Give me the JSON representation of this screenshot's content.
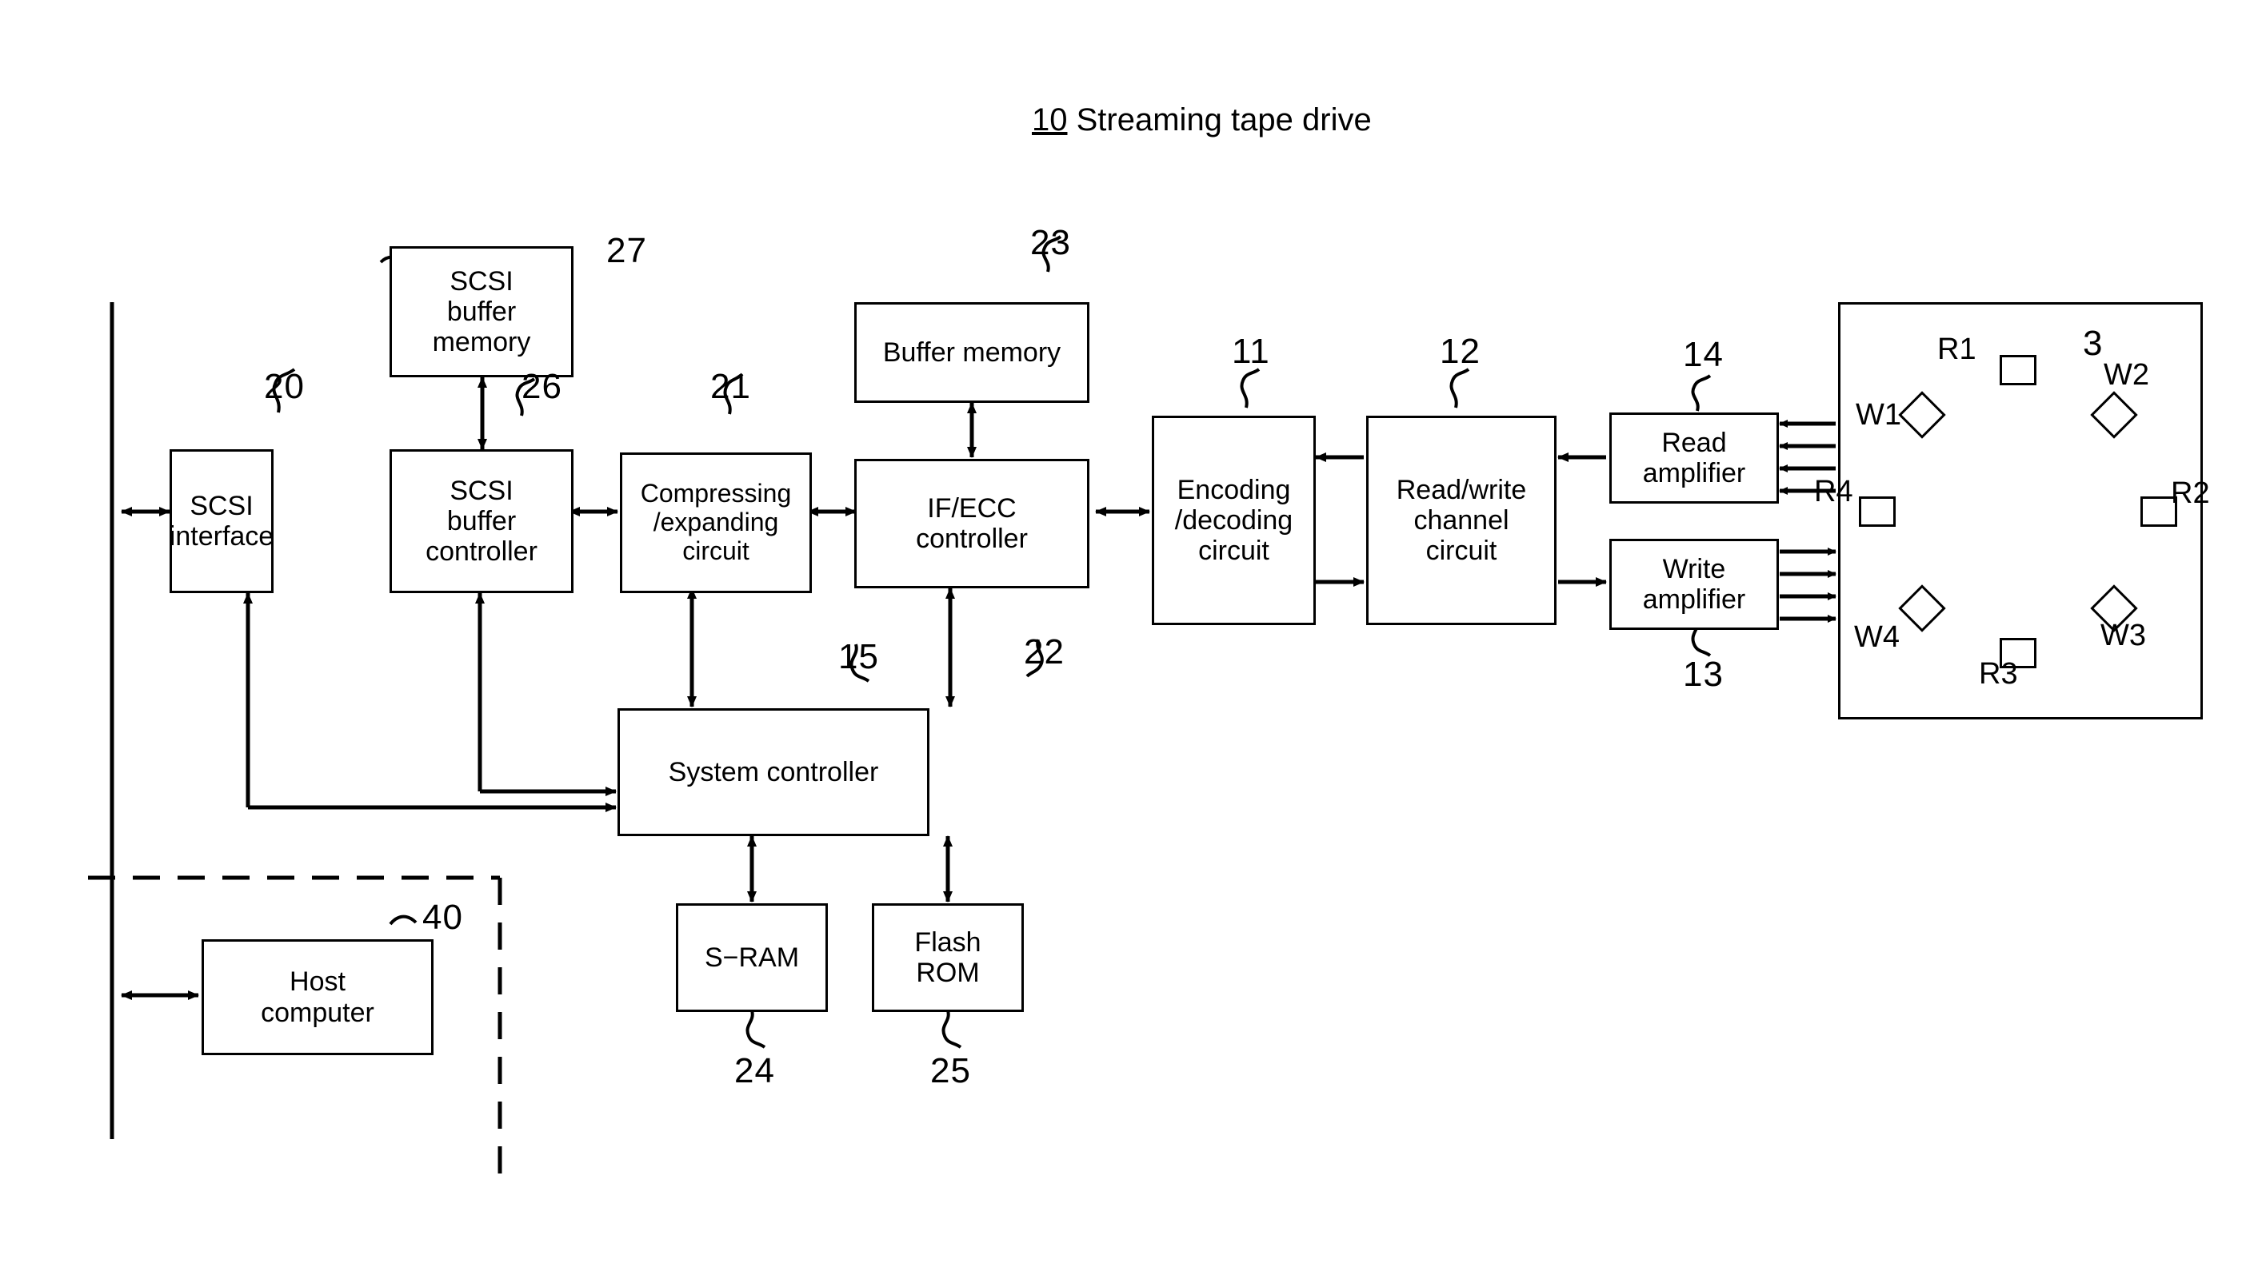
{
  "figure": {
    "title_number": "10",
    "title_text": "Streaming tape drive"
  },
  "blocks": {
    "scsi_interface": {
      "label": "SCSI\ninterface",
      "ref": "20"
    },
    "scsi_buffer_memory": {
      "label": "SCSI\nbuffer\nmemory",
      "ref": "27"
    },
    "scsi_buffer_ctrl": {
      "label": "SCSI\nbuffer\ncontroller",
      "ref": "26"
    },
    "compress_expand": {
      "label": "Compressing\n/expanding\ncircuit",
      "ref": "21"
    },
    "buffer_memory": {
      "label": "Buffer memory",
      "ref": "23"
    },
    "ifecc_controller": {
      "label": "IF/ECC\ncontroller",
      "ref": "22"
    },
    "encode_decode": {
      "label": "Encoding\n/decoding\ncircuit",
      "ref": "11"
    },
    "rw_channel": {
      "label": "Read/write\nchannel\ncircuit",
      "ref": "12"
    },
    "read_amplifier": {
      "label": "Read\namplifier",
      "ref": "14"
    },
    "write_amplifier": {
      "label": "Write\namplifier",
      "ref": "13"
    },
    "system_controller": {
      "label": "System controller",
      "ref": "15"
    },
    "sram": {
      "label": "S−RAM",
      "ref": "24"
    },
    "flash_rom": {
      "label": "Flash\nROM",
      "ref": "25"
    },
    "host_computer": {
      "label": "Host\ncomputer",
      "ref": "40"
    }
  },
  "drum": {
    "ref": "3",
    "heads": [
      {
        "name": "R1",
        "type": "read",
        "label": "R1"
      },
      {
        "name": "W2",
        "type": "write",
        "label": "W2"
      },
      {
        "name": "R2",
        "type": "read",
        "label": "R2"
      },
      {
        "name": "W3",
        "type": "write",
        "label": "W3"
      },
      {
        "name": "R3",
        "type": "read",
        "label": "R3"
      },
      {
        "name": "W4",
        "type": "write",
        "label": "W4"
      },
      {
        "name": "R4",
        "type": "read",
        "label": "R4"
      },
      {
        "name": "W1",
        "type": "write",
        "label": "W1"
      }
    ]
  },
  "colors": {
    "line": "#000000",
    "background": "#ffffff"
  }
}
